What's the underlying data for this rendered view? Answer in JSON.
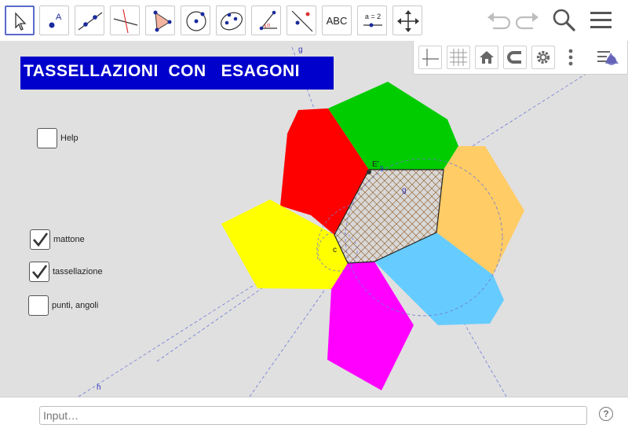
{
  "toolbar": {
    "tools": [
      {
        "name": "move-tool"
      },
      {
        "name": "point-tool"
      },
      {
        "name": "line-tool"
      },
      {
        "name": "perpendicular-line-tool"
      },
      {
        "name": "polygon-tool"
      },
      {
        "name": "circle-tool"
      },
      {
        "name": "ellipse-tool"
      },
      {
        "name": "angle-tool"
      },
      {
        "name": "reflect-tool"
      },
      {
        "name": "text-tool",
        "label": "ABC"
      },
      {
        "name": "slider-tool",
        "label": "a = 2"
      },
      {
        "name": "move-view-tool"
      }
    ]
  },
  "style_bar": {
    "buttons": [
      "axes-icon",
      "grid-icon",
      "home-icon",
      "magnet-icon",
      "gear-icon",
      "more-icon",
      "view-options-icon"
    ]
  },
  "canvas": {
    "title": "TASSELLAZIONI  CON   ESAGONI",
    "checkboxes": [
      {
        "label": "Help",
        "checked": false
      },
      {
        "label": "mattone",
        "checked": true
      },
      {
        "label": "tassellazione",
        "checked": true
      },
      {
        "label": "punti, angoli",
        "checked": false
      }
    ],
    "labels": {
      "line_g_top": "g",
      "line_g_inner": "g",
      "line_h": "h",
      "point_c": "c",
      "point_E": "E'",
      "point_9": "9"
    },
    "colors": {
      "red": "#ff0000",
      "green": "#00cc00",
      "orange": "#ffcc66",
      "blue": "#66ccff",
      "magenta": "#ff00ff",
      "yellow": "#ffff00",
      "title_bg": "#0000cc"
    }
  },
  "input_bar": {
    "placeholder": "Input…",
    "help_label": "?"
  }
}
